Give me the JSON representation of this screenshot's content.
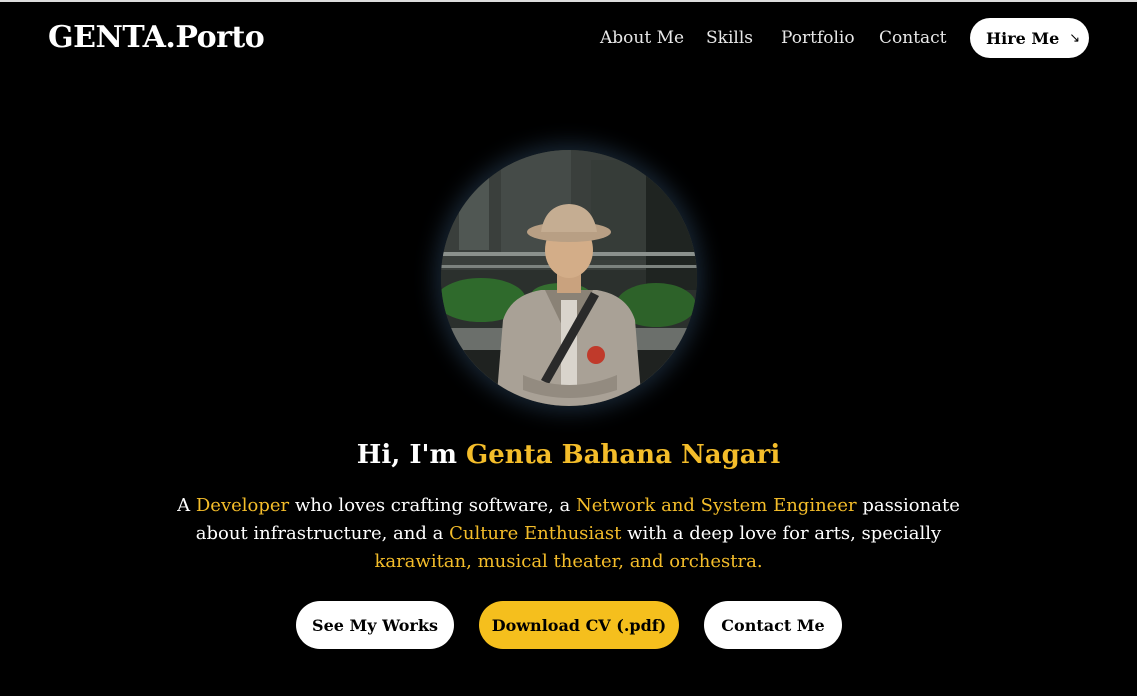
{
  "header": {
    "brand": "GENTA.Porto",
    "nav": [
      "About Me",
      "Skills",
      "Portfolio",
      "Contact"
    ],
    "hire_label": "Hire Me",
    "hire_icon": "arrow-down-right-icon"
  },
  "hero": {
    "avatar_alt": "Profile photo",
    "greeting": "Hi, I'm",
    "name": "Genta Bahana Nagari",
    "desc": {
      "p1": "A ",
      "h1": "Developer",
      "p2": " who loves crafting software, a ",
      "h2": "Network and System Engineer",
      "p3": " passionate about infrastructure, and a ",
      "h3": "Culture Enthusiast",
      "p4": " with a deep love for arts, specially ",
      "h4": "karawitan, musical theater, and orchestra."
    },
    "buttons": {
      "works": "See My Works",
      "cv": "Download CV (.pdf)",
      "contact": "Contact Me"
    }
  },
  "colors": {
    "background": "#000000",
    "accent": "#f4bd2a",
    "button_light": "#ffffff"
  }
}
